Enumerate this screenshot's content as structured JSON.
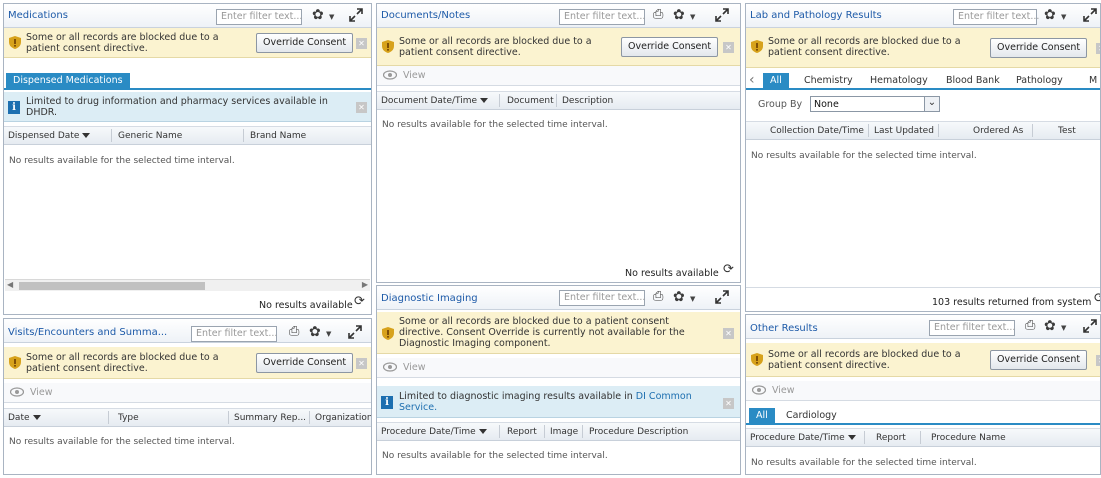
{
  "common": {
    "filter_placeholder": "Enter filter text...",
    "consent_warning": "Some or all records are blocked due to a patient consent directive.",
    "override_label": "Override Consent",
    "view_label": "View",
    "no_results_interval": "No results available for the selected time interval.",
    "no_results": "No results available"
  },
  "medications": {
    "title": "Medications",
    "tab": "Dispensed Medications",
    "info": "Limited to drug information and pharmacy services available in DHDR.",
    "columns": [
      "Dispensed Date",
      "Generic Name",
      "Brand Name"
    ]
  },
  "visits": {
    "title": "Visits/Encounters and Summa...",
    "columns": [
      "Date",
      "Type",
      "Summary Rep...",
      "Organization"
    ]
  },
  "documents": {
    "title": "Documents/Notes",
    "columns": [
      "Document Date/Time",
      "Document",
      "Description"
    ]
  },
  "imaging": {
    "title": "Diagnostic Imaging",
    "warning": "Some or all records are blocked due to a patient consent directive. Consent Override is currently not available for the Diagnostic Imaging component.",
    "info_prefix": "Limited to diagnostic imaging results available in ",
    "info_link": "DI Common Service.",
    "columns": [
      "Procedure Date/Time",
      "Report",
      "Image",
      "Procedure Description"
    ]
  },
  "lab": {
    "title": "Lab and Pathology Results",
    "tabs": [
      "All",
      "Chemistry",
      "Hematology",
      "Blood Bank",
      "Pathology",
      "M"
    ],
    "group_by_label": "Group By",
    "group_by_value": "None",
    "columns": [
      "Collection Date/Time",
      "Last Updated",
      "Ordered As",
      "Test"
    ],
    "footer": "103 results returned from system"
  },
  "other": {
    "title": "Other Results",
    "tabs": [
      "All",
      "Cardiology"
    ],
    "columns": [
      "Procedure Date/Time",
      "Report",
      "Procedure Name"
    ]
  },
  "colors": {
    "title_blue": "#1d5aa8",
    "tab_blue": "#2a8bc4",
    "warning_bg": "#fbf3d0",
    "info_bg": "#dcedf5"
  }
}
